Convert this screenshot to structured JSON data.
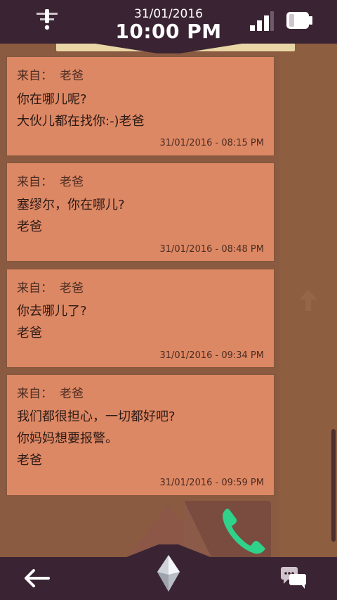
{
  "status": {
    "date": "31/01/2016",
    "time": "10:00 PM"
  },
  "messages": [
    {
      "from_label": "来自：",
      "sender": "老爸",
      "lines": [
        "你在哪儿呢?",
        "大伙儿都在找你:-)老爸"
      ],
      "timestamp": "31/01/2016 - 08:15 PM"
    },
    {
      "from_label": "来自：",
      "sender": "老爸",
      "lines": [
        "塞缪尔，你在哪儿?",
        "老爸"
      ],
      "timestamp": "31/01/2016 - 08:48 PM"
    },
    {
      "from_label": "来自：",
      "sender": "老爸",
      "lines": [
        "你去哪儿了?",
        "老爸"
      ],
      "timestamp": "31/01/2016 - 09:34 PM"
    },
    {
      "from_label": "来自：",
      "sender": "老爸",
      "lines": [
        "我们都很担心，一切都好吧?",
        "你妈妈想要报警。",
        "老爸"
      ],
      "timestamp": "31/01/2016 - 09:59 PM"
    }
  ],
  "icons": {
    "notification": "notification-icon",
    "signal": "signal-icon",
    "battery": "battery-icon",
    "call": "phone-icon",
    "back": "back-arrow-icon",
    "home": "crystal-icon",
    "messages": "chat-icon"
  },
  "colors": {
    "bar": "#3a2433",
    "message_bg": "#dd8864",
    "background": "#8a5b40",
    "call_green": "#2fd28a"
  }
}
